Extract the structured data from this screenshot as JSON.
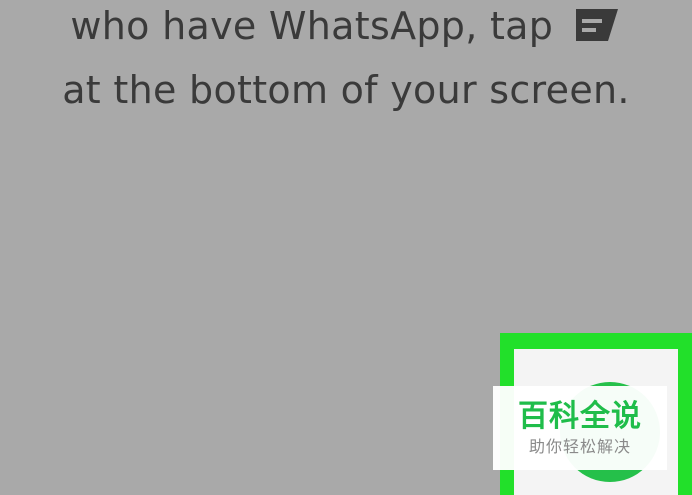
{
  "instructions": {
    "line1": "who have WhatsApp, tap",
    "line2": "at the bottom of your screen."
  },
  "icons": {
    "inline_icon": "new-chat-icon",
    "fab_icon": "new-chat-fab"
  },
  "watermark": {
    "title": "百科全说",
    "subtitle": "助你轻松解决"
  },
  "colors": {
    "background": "#a9a9a9",
    "highlight": "#22e02a",
    "fab": "#25c04a",
    "watermark_title": "#1fbd4a"
  }
}
